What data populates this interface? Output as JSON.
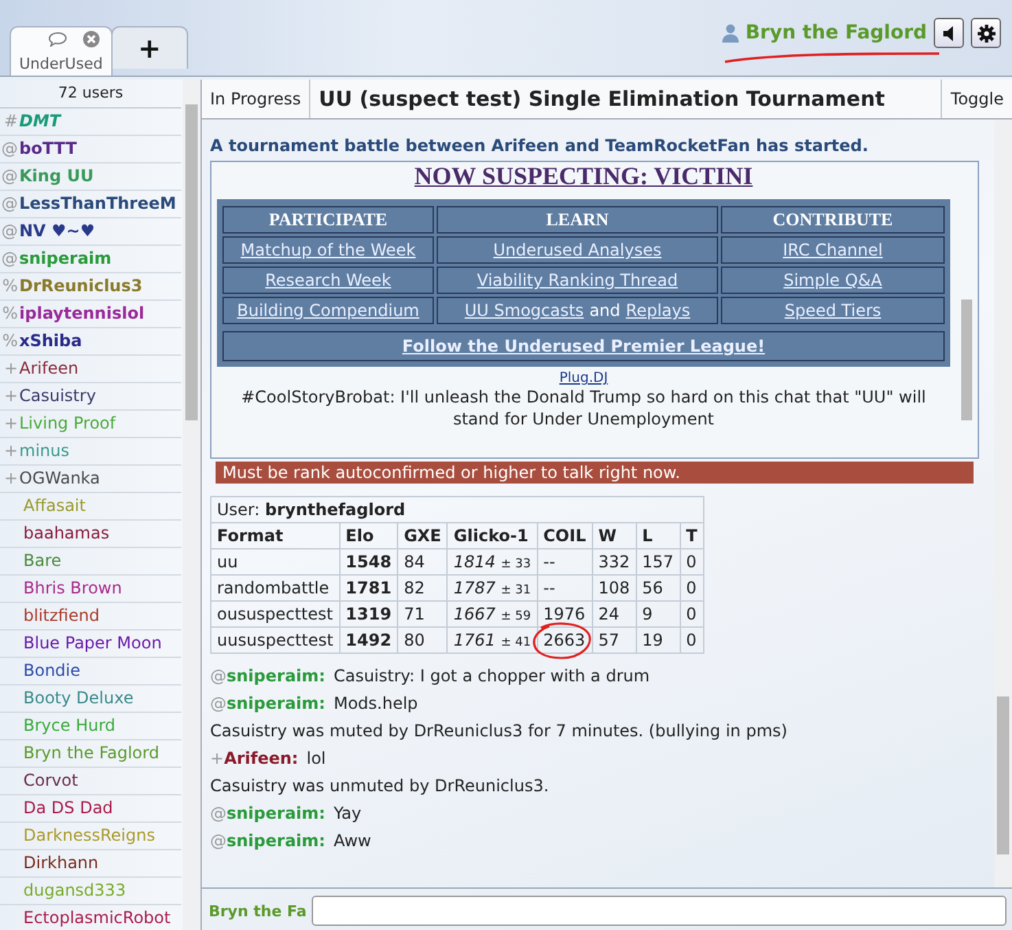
{
  "tabs": [
    {
      "kind": "room",
      "label": "UnderUsed",
      "selected": true
    },
    {
      "kind": "new",
      "label": "+",
      "selected": false
    }
  ],
  "header": {
    "username": "Bryn the Faglord",
    "annotated": true
  },
  "userlist": {
    "count": "72 users",
    "users": [
      {
        "group": "#",
        "name": "DMT",
        "bold": true,
        "italic": true,
        "color": "#1a9a7a"
      },
      {
        "group": "@",
        "name": "boTTT",
        "bold": true,
        "italic": false,
        "color": "#5a2a8a"
      },
      {
        "group": "@",
        "name": "King UU",
        "bold": true,
        "italic": false,
        "color": "#3a9a5a"
      },
      {
        "group": "@",
        "name": "LessThanThreeM",
        "bold": true,
        "italic": false,
        "color": "#2a4a7a"
      },
      {
        "group": "@",
        "name": "NV ♥~♥",
        "bold": true,
        "italic": false,
        "color": "#2a3a8a"
      },
      {
        "group": "@",
        "name": "sniperaim",
        "bold": true,
        "italic": false,
        "color": "#2a9a3a"
      },
      {
        "group": "%",
        "name": "DrReuniclus3",
        "bold": true,
        "italic": false,
        "color": "#8a7a2a"
      },
      {
        "group": "%",
        "name": "iplaytennislol",
        "bold": true,
        "italic": false,
        "color": "#9a2a9a"
      },
      {
        "group": "%",
        "name": "xShiba",
        "bold": true,
        "italic": false,
        "color": "#2a2a8a"
      },
      {
        "group": "+",
        "name": "Arifeen",
        "bold": false,
        "italic": false,
        "color": "#8a2a3a"
      },
      {
        "group": "+",
        "name": "Casuistry",
        "bold": false,
        "italic": false,
        "color": "#3a3a6a"
      },
      {
        "group": "+",
        "name": "Living Proof",
        "bold": false,
        "italic": false,
        "color": "#4aaa3a"
      },
      {
        "group": "+",
        "name": "minus",
        "bold": false,
        "italic": false,
        "color": "#3a9a8a"
      },
      {
        "group": "+",
        "name": "OGWanka",
        "bold": false,
        "italic": false,
        "color": "#4a4a4a"
      },
      {
        "name": "Affasait",
        "bold": false,
        "italic": false,
        "color": "#9a9a2a"
      },
      {
        "name": "baahamas",
        "bold": false,
        "italic": false,
        "color": "#8a1a3a"
      },
      {
        "name": "Bare",
        "bold": false,
        "italic": false,
        "color": "#4a8a3a"
      },
      {
        "name": "Bhris Brown",
        "bold": false,
        "italic": false,
        "color": "#aa2a8a"
      },
      {
        "name": "blitzfiend",
        "bold": false,
        "italic": false,
        "color": "#aa3a2a"
      },
      {
        "name": "Blue Paper Moon",
        "bold": false,
        "italic": false,
        "color": "#6a1aaa"
      },
      {
        "name": "Bondie",
        "bold": false,
        "italic": false,
        "color": "#2a4aaa"
      },
      {
        "name": "Booty Deluxe",
        "bold": false,
        "italic": false,
        "color": "#3a8a8a"
      },
      {
        "name": "Bryce Hurd",
        "bold": false,
        "italic": false,
        "color": "#3aaa3a"
      },
      {
        "name": "Bryn the Faglord",
        "bold": false,
        "italic": false,
        "color": "#5a9a2a"
      },
      {
        "name": "Corvot",
        "bold": false,
        "italic": false,
        "color": "#6a2a4a"
      },
      {
        "name": "Da DS Dad",
        "bold": false,
        "italic": false,
        "color": "#aa1a4a"
      },
      {
        "name": "DarknessReigns",
        "bold": false,
        "italic": false,
        "color": "#aa9a2a"
      },
      {
        "name": "Dirkhann",
        "bold": false,
        "italic": false,
        "color": "#7a2a1a"
      },
      {
        "name": "dugansd333",
        "bold": false,
        "italic": false,
        "color": "#7aaa2a"
      },
      {
        "name": "EctoplasmicRobot",
        "bold": false,
        "italic": false,
        "color": "#aa1a4a"
      }
    ]
  },
  "tournament": {
    "status": "In Progress",
    "title": "UU (suspect test) Single Elimination Tournament",
    "toggle": "Toggle"
  },
  "announcement": "A tournament battle between Arifeen and TeamRocketFan has started.",
  "banner": {
    "heading": "NOW SUSPECTING: VICTINI",
    "columns": [
      "PARTICIPATE",
      "LEARN",
      "CONTRIBUTE"
    ],
    "rows": [
      [
        [
          "Matchup of the Week"
        ],
        [
          "Underused Analyses"
        ],
        [
          "IRC Channel"
        ]
      ],
      [
        [
          "Research Week"
        ],
        [
          "Viability Ranking Thread"
        ],
        [
          "Simple Q&A"
        ]
      ],
      [
        [
          "Building Compendium"
        ],
        [
          "UU Smogcasts",
          "and",
          "Replays"
        ],
        [
          "Speed Tiers"
        ]
      ]
    ],
    "footer": "Follow the Underused Premier League!",
    "plug": "Plug.DJ",
    "message": "#CoolStoryBrobat: I'll unleash the Donald Trump so hard on this chat that \"UU\" will stand for Under Unemployment",
    "warning": "Must be rank autoconfirmed or higher to talk right now."
  },
  "ranking": {
    "user_label": "User:",
    "user": "brynthefaglord",
    "columns": [
      "Format",
      "Elo",
      "GXE",
      "Glicko-1",
      "COIL",
      "W",
      "L",
      "T"
    ],
    "rows": [
      {
        "format": "uu",
        "elo": "1548",
        "gxe": "84",
        "glicko": "1814",
        "dev": "± 33",
        "coil": "--",
        "w": "332",
        "l": "157",
        "t": "0",
        "circled": false
      },
      {
        "format": "randombattle",
        "elo": "1781",
        "gxe": "82",
        "glicko": "1787",
        "dev": "± 31",
        "coil": "--",
        "w": "108",
        "l": "56",
        "t": "0",
        "circled": false
      },
      {
        "format": "oususpecttest",
        "elo": "1319",
        "gxe": "71",
        "glicko": "1667",
        "dev": "± 59",
        "coil": "1976",
        "w": "24",
        "l": "9",
        "t": "0",
        "circled": false
      },
      {
        "format": "uususpecttest",
        "elo": "1492",
        "gxe": "80",
        "glicko": "1761",
        "dev": "± 41",
        "coil": "2663",
        "w": "57",
        "l": "19",
        "t": "0",
        "circled": true
      }
    ]
  },
  "messages": [
    {
      "kind": "chat",
      "group": "@",
      "user": "sniperaim:",
      "color": "#2a9a3a",
      "text": "Casuistry: I got a chopper with a drum"
    },
    {
      "kind": "chat",
      "group": "@",
      "user": "sniperaim:",
      "color": "#2a9a3a",
      "text": "Mods.help"
    },
    {
      "kind": "notice",
      "text": "Casuistry was muted by DrReuniclus3 for 7 minutes. (bullying in pms)"
    },
    {
      "kind": "chat",
      "group": "+",
      "user": "Arifeen:",
      "color": "#8a1a2a",
      "text": "lol"
    },
    {
      "kind": "notice",
      "text": "Casuistry was unmuted by DrReuniclus3."
    },
    {
      "kind": "chat",
      "group": "@",
      "user": "sniperaim:",
      "color": "#2a9a3a",
      "text": "Yay"
    },
    {
      "kind": "chat",
      "group": "@",
      "user": "sniperaim:",
      "color": "#2a9a3a",
      "text": "Aww"
    }
  ],
  "composer": {
    "name": "Bryn the Fa"
  }
}
